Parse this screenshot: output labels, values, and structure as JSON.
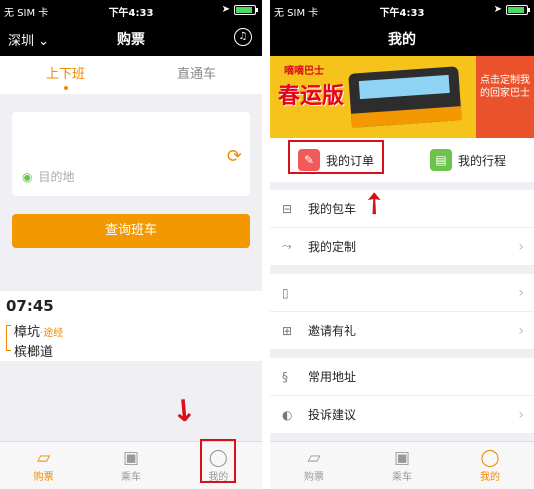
{
  "status": {
    "carrier": "无 SIM 卡",
    "time": "下午4:33"
  },
  "left": {
    "nav": {
      "city": "深圳",
      "title": "购票"
    },
    "tabs": [
      {
        "label": "上下班"
      },
      {
        "label": "直通车"
      }
    ],
    "route": {
      "destination_placeholder": "目的地"
    },
    "search_label": "查询班车",
    "trip": {
      "time": "07:45",
      "stop_from": "樟坑",
      "via_label": "·途经",
      "stop_to": "槟榔道"
    },
    "tabbar": [
      {
        "label": "购票",
        "icon": "ticket-icon"
      },
      {
        "label": "乘车",
        "icon": "ride-icon"
      },
      {
        "label": "我的",
        "icon": "user-icon"
      }
    ]
  },
  "right": {
    "nav": {
      "title": "我的"
    },
    "banner": {
      "brand": "嘀嘀巴士",
      "headline": "春运版",
      "cta": "点击定制我的回家巴士"
    },
    "orders": [
      {
        "label": "我的订单",
        "color": "#f05a5a"
      },
      {
        "label": "我的行程",
        "color": "#6cc24a"
      }
    ],
    "menu": [
      {
        "label": "我的包车",
        "icon": "bus-icon"
      },
      {
        "label": "我的定制",
        "icon": "custom-icon"
      },
      {
        "label": "",
        "icon": "document-icon"
      },
      {
        "label": "邀请有礼",
        "icon": "gift-icon"
      },
      {
        "label": "常用地址",
        "icon": "address-icon"
      },
      {
        "label": "投诉建议",
        "icon": "feedback-icon"
      }
    ],
    "tabbar": [
      {
        "label": "购票",
        "icon": "ticket-icon"
      },
      {
        "label": "乘车",
        "icon": "ride-icon"
      },
      {
        "label": "我的",
        "icon": "user-icon"
      }
    ]
  },
  "colors": {
    "accent": "#f08a00",
    "highlight": "#d8101a"
  }
}
